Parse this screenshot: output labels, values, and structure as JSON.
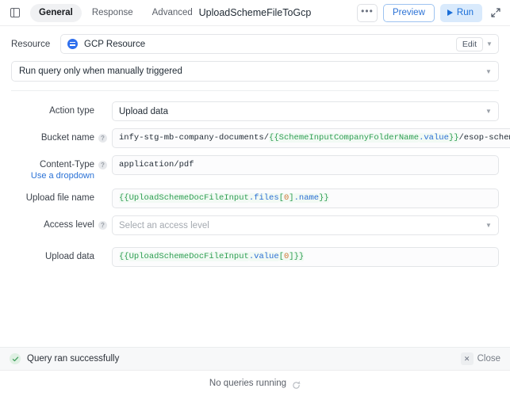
{
  "header": {
    "panel_toggle_icon": "panel-left-icon",
    "tabs": [
      {
        "label": "General",
        "active": true
      },
      {
        "label": "Response",
        "active": false
      },
      {
        "label": "Advanced",
        "active": false
      }
    ],
    "title": "UploadSchemeFileToGcp",
    "more_label": "•••",
    "preview_label": "Preview",
    "run_label": "Run",
    "run_icon": "play-icon",
    "expand_icon": "expand-arrows-icon",
    "accent_blue": "#2b72d6",
    "run_bg": "#d9eafc"
  },
  "resource": {
    "label": "Resource",
    "icon": "gcp-resource-icon",
    "name": "GCP Resource",
    "edit_label": "Edit",
    "caret_icon": "chevron-down-icon"
  },
  "trigger": {
    "value": "Run query only when manually triggered",
    "caret_icon": "chevron-down-icon"
  },
  "fields": [
    {
      "id": "action-type",
      "label": "Action type",
      "sub_label": null,
      "has_help": false,
      "type": "select",
      "value": "Upload data",
      "placeholder": null
    },
    {
      "id": "bucket-name",
      "label": "Bucket name",
      "sub_label": null,
      "has_help": true,
      "type": "code",
      "value": "infy-stg-mb-company-documents/{{SchemeInputCompanyFolderName.value}}/esop-schemes/",
      "tokens": [
        {
          "t": "infy-stg-mb-company-documents/",
          "c": "plain"
        },
        {
          "t": "{{",
          "c": "brace"
        },
        {
          "t": "SchemeInputCompanyFolderName",
          "c": "name"
        },
        {
          "t": ".value",
          "c": "prop"
        },
        {
          "t": "}}",
          "c": "brace"
        },
        {
          "t": "/esop-schemes/",
          "c": "plain"
        }
      ]
    },
    {
      "id": "content-type",
      "label": "Content-Type",
      "sub_label": "Use a dropdown",
      "has_help": true,
      "type": "code",
      "value": "application/pdf",
      "tokens": [
        {
          "t": "application/pdf",
          "c": "plain"
        }
      ]
    },
    {
      "id": "upload-file-name",
      "label": "Upload file name",
      "sub_label": null,
      "has_help": false,
      "type": "code",
      "value": "{{UploadSchemeDocFileInput.files[0].name}}",
      "tokens": [
        {
          "t": "{{",
          "c": "brace"
        },
        {
          "t": "UploadSchemeDocFileInput",
          "c": "name"
        },
        {
          "t": ".files",
          "c": "prop"
        },
        {
          "t": "[",
          "c": "brace"
        },
        {
          "t": "0",
          "c": "num"
        },
        {
          "t": "]",
          "c": "brace"
        },
        {
          "t": ".name",
          "c": "prop"
        },
        {
          "t": "}}",
          "c": "brace"
        }
      ]
    },
    {
      "id": "access-level",
      "label": "Access level",
      "sub_label": null,
      "has_help": true,
      "type": "select",
      "value": null,
      "placeholder": "Select an access level"
    },
    {
      "id": "upload-data",
      "label": "Upload data",
      "sub_label": null,
      "has_help": false,
      "type": "code",
      "value": "{{UploadSchemeDocFileInput.value[0]}}",
      "tokens": [
        {
          "t": "{{",
          "c": "brace"
        },
        {
          "t": "UploadSchemeDocFileInput",
          "c": "name"
        },
        {
          "t": ".value",
          "c": "prop"
        },
        {
          "t": "[",
          "c": "brace"
        },
        {
          "t": "0",
          "c": "num"
        },
        {
          "t": "]",
          "c": "brace"
        },
        {
          "t": "}}",
          "c": "brace"
        }
      ]
    }
  ],
  "status": {
    "icon": "check-circle-icon",
    "message": "Query ran successfully",
    "close_label": "Close",
    "close_icon": "close-icon"
  },
  "footer": {
    "message": "No queries running",
    "icon": "refresh-icon"
  }
}
